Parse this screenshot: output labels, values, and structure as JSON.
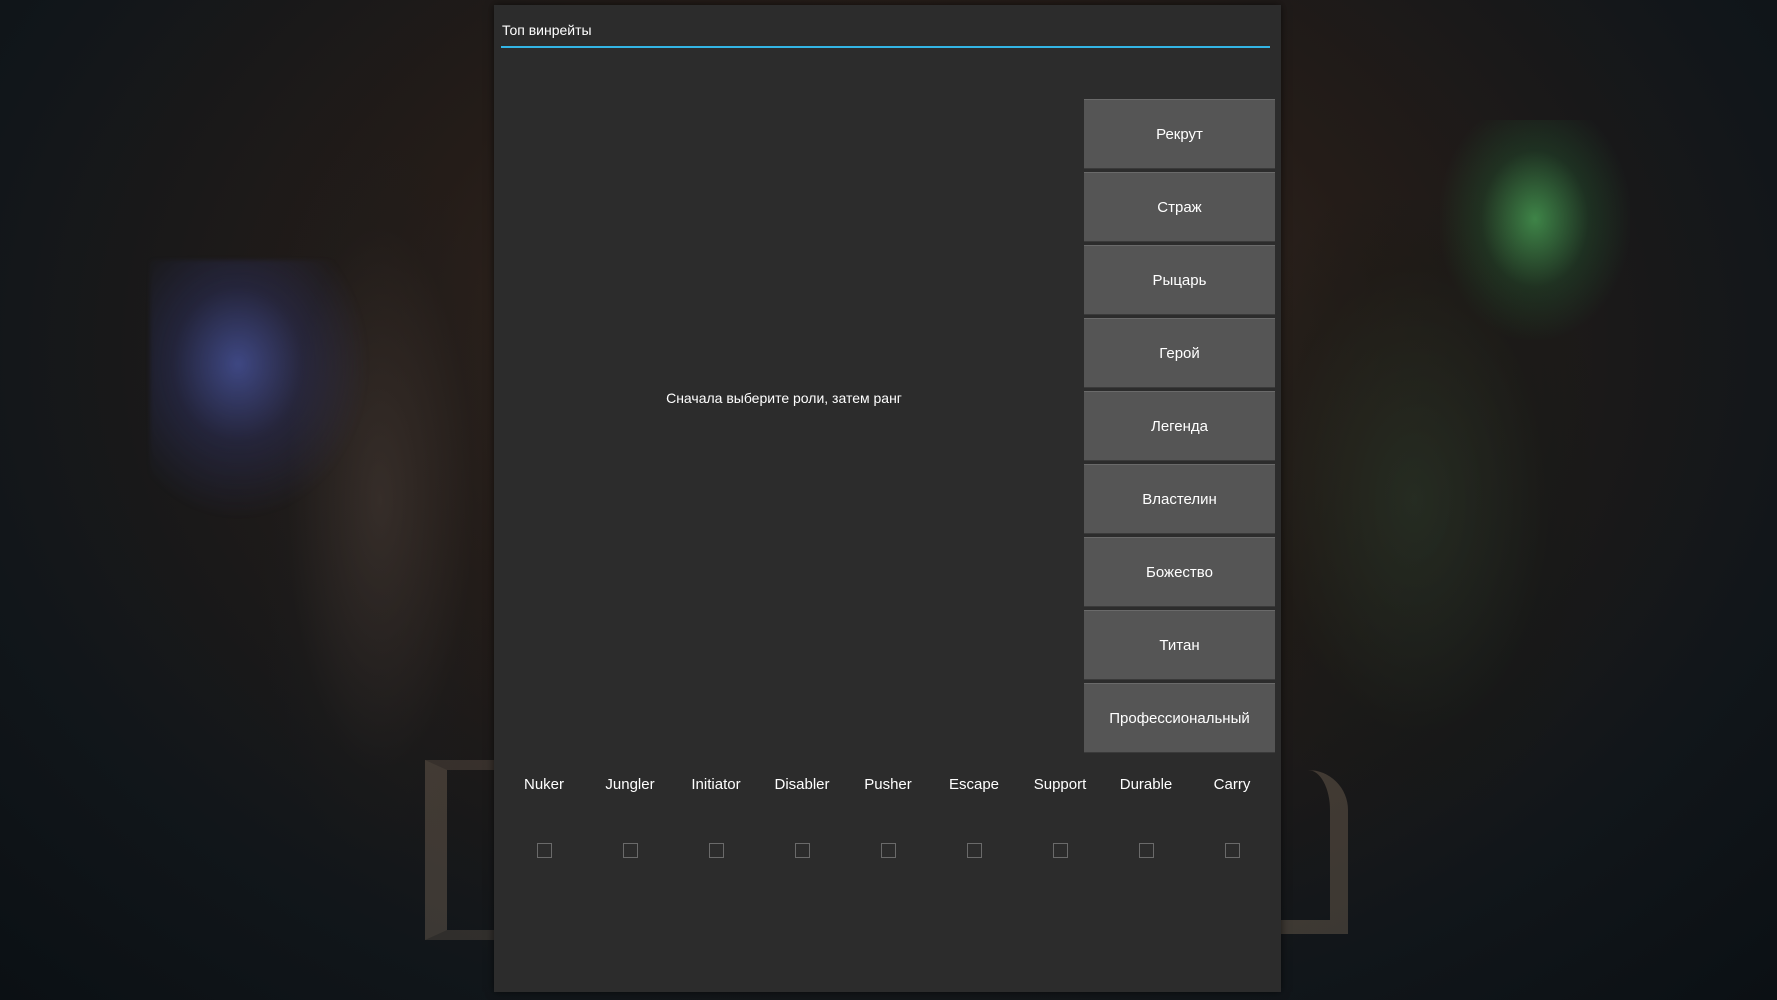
{
  "dialog": {
    "title": "Топ винрейты",
    "message": "Сначала выберите роли, затем ранг",
    "accent_color": "#33b5e5"
  },
  "ranks": [
    "Рекрут",
    "Страж",
    "Рыцарь",
    "Герой",
    "Легенда",
    "Властелин",
    "Божество",
    "Титан",
    "Профессиональный"
  ],
  "roles": [
    {
      "label": "Nuker",
      "checked": false
    },
    {
      "label": "Jungler",
      "checked": false
    },
    {
      "label": "Initiator",
      "checked": false
    },
    {
      "label": "Disabler",
      "checked": false
    },
    {
      "label": "Pusher",
      "checked": false
    },
    {
      "label": "Escape",
      "checked": false
    },
    {
      "label": "Support",
      "checked": false
    },
    {
      "label": "Durable",
      "checked": false
    },
    {
      "label": "Carry",
      "checked": false
    }
  ]
}
